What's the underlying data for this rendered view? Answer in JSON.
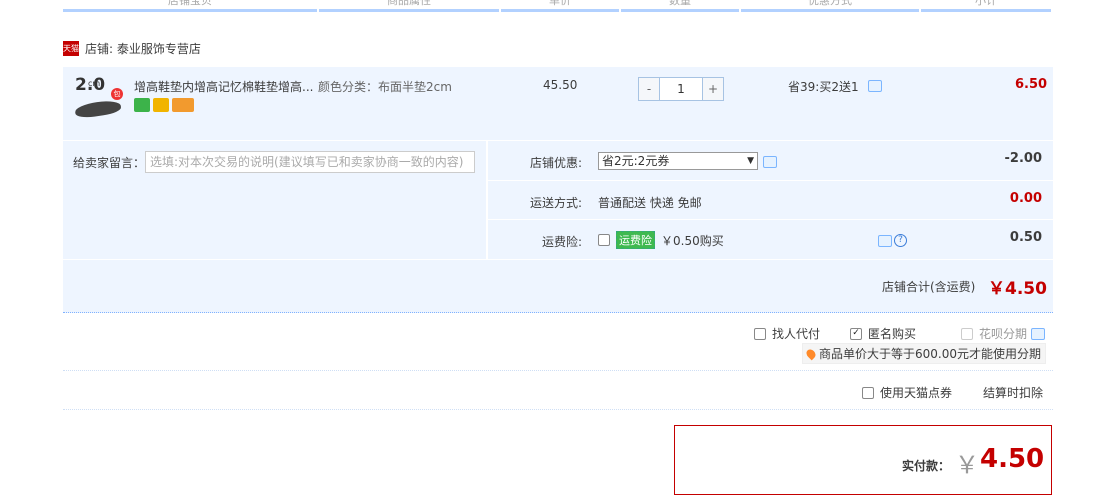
{
  "header": {
    "columns": [
      "店铺宝贝",
      "商品属性",
      "单价",
      "数量",
      "优惠方式",
      "小计"
    ]
  },
  "shop": {
    "icon_label": "天猫",
    "label": "店铺: 泰业服饰专营店"
  },
  "item": {
    "thumb_num": "2.0",
    "thumb_sub": "cm",
    "thumb_badge": "包",
    "title": "增高鞋垫内增高记忆棉鞋垫增高...",
    "sku": "颜色分类：布面半垫2cm",
    "unit_price": "45.50",
    "qty_minus": "-",
    "qty_value": "1",
    "qty_plus": "+",
    "promo": "省39:买2送1",
    "subtotal": "6.50",
    "services": [
      {
        "name": "7day-icon",
        "color": "#3cb34a"
      },
      {
        "name": "guarantee-icon",
        "color": "#f1b400"
      },
      {
        "name": "card-icon",
        "color": "#f29a2e"
      }
    ]
  },
  "message": {
    "label": "给卖家留言：",
    "placeholder": "选填:对本次交易的说明(建议填写已和卖家协商一致的内容)"
  },
  "store_discount": {
    "label": "店铺优惠:",
    "selected": "省2元:2元券",
    "value": "-2.00"
  },
  "shipping": {
    "label": "运送方式:",
    "value_text": "普通配送 快递 免邮",
    "value": "0.00"
  },
  "insurance": {
    "label": "运费险:",
    "tag": "运费险",
    "text": "￥0.50购买",
    "value": "0.50"
  },
  "store_total": {
    "label": "店铺合计(含运费)",
    "value": "￥4.50"
  },
  "options": {
    "proxy": "找人代付",
    "anonymous": "匿名购买",
    "huabei": "花呗分期",
    "hint": "商品单价大于等于600.00元才能使用分期",
    "tmall_points": "使用天猫点券",
    "deduct": "结算时扣除"
  },
  "payment": {
    "label": "实付款：",
    "currency": "￥",
    "value": "4.50"
  }
}
